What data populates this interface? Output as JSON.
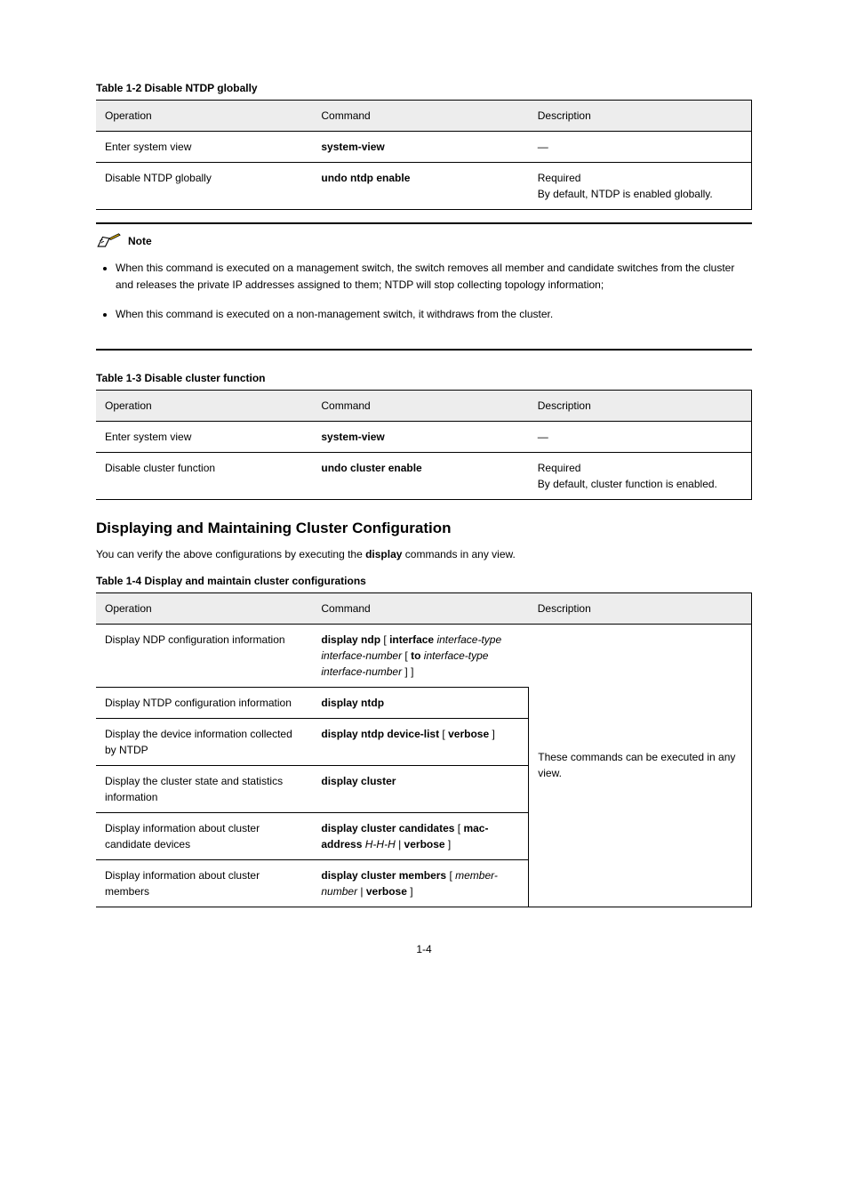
{
  "page_number": "1-4",
  "tables": {
    "t1": {
      "caption": "Table 1-2 Disable NTDP globally",
      "headers": [
        "Operation",
        "Command",
        "Description"
      ],
      "rows": [
        {
          "c1": "Enter system view",
          "c2": "<span class='cmd-bold'>system-view</span>",
          "c3": "—"
        },
        {
          "c1": "Disable NTDP globally",
          "c2": "<span class='cmd-bold'>undo ntdp enable</span>",
          "c3": "Required<br>By default, NTDP is enabled globally."
        }
      ]
    },
    "t2": {
      "caption": "Table 1-3 Disable cluster function",
      "headers": [
        "Operation",
        "Command",
        "Description"
      ],
      "rows": [
        {
          "c1": "Enter system view",
          "c2": "<span class='cmd-bold'>system-view</span>",
          "c3": "—"
        },
        {
          "c1": "Disable cluster function",
          "c2": "<span class='cmd-bold'>undo cluster enable</span>",
          "c3": "Required<br>By default, cluster function is enabled."
        }
      ]
    },
    "t3": {
      "caption": "Table 1-4 Display and maintain cluster configurations",
      "headers": [
        "Operation",
        "Command",
        "Description"
      ],
      "rows": [
        {
          "c1": "Display NDP configuration information",
          "c2": "<span class='cmd-bold'>display ndp</span> [ <span class='cmd-bold'>interface</span> <span class='cmd-ital'>interface-type interface-number</span> [ <span class='cmd-bold'>to</span> <span class='cmd-ital'>interface-type interface-number</span> ] ]",
          "c3": ""
        },
        {
          "c1": "Display NTDP configuration information",
          "c2": "<span class='cmd-bold'>display ntdp</span>",
          "c3": ""
        },
        {
          "c1": "Display the device information collected by NTDP",
          "c2": "<span class='cmd-bold'>display ntdp device-list</span> [ <span class='cmd-bold'>verbose</span> ]",
          "c3": "These commands can be executed in any view."
        },
        {
          "c1": "Display the cluster state and statistics information",
          "c2": "<span class='cmd-bold'>display cluster</span>",
          "c3": ""
        },
        {
          "c1": "Display information about cluster candidate devices",
          "c2": "<span class='cmd-bold'>display cluster candidates</span> [ <span class='cmd-bold'>mac-address</span> <span class='cmd-ital'>H-H-H</span> | <span class='cmd-bold'>verbose</span> ]",
          "c3": ""
        },
        {
          "c1": "Display information about cluster members",
          "c2": "<span class='cmd-bold'>display cluster members</span> [ <span class='cmd-ital'>member-number</span> | <span class='cmd-bold'>verbose</span> ]",
          "c3": ""
        }
      ]
    }
  },
  "note": {
    "label": "Note",
    "items": [
      "When this command is executed on a management switch, the switch removes all member and candidate switches from the cluster and releases the private IP addresses assigned to them; NTDP will stop collecting topology information;",
      "When this command is executed on a non-management switch, it withdraws from the cluster."
    ]
  },
  "section": {
    "title": "Displaying and Maintaining Cluster Configuration",
    "after_text": "You can verify the above configurations by executing the <span class='cmd-bold'>display</span> commands in any view."
  }
}
